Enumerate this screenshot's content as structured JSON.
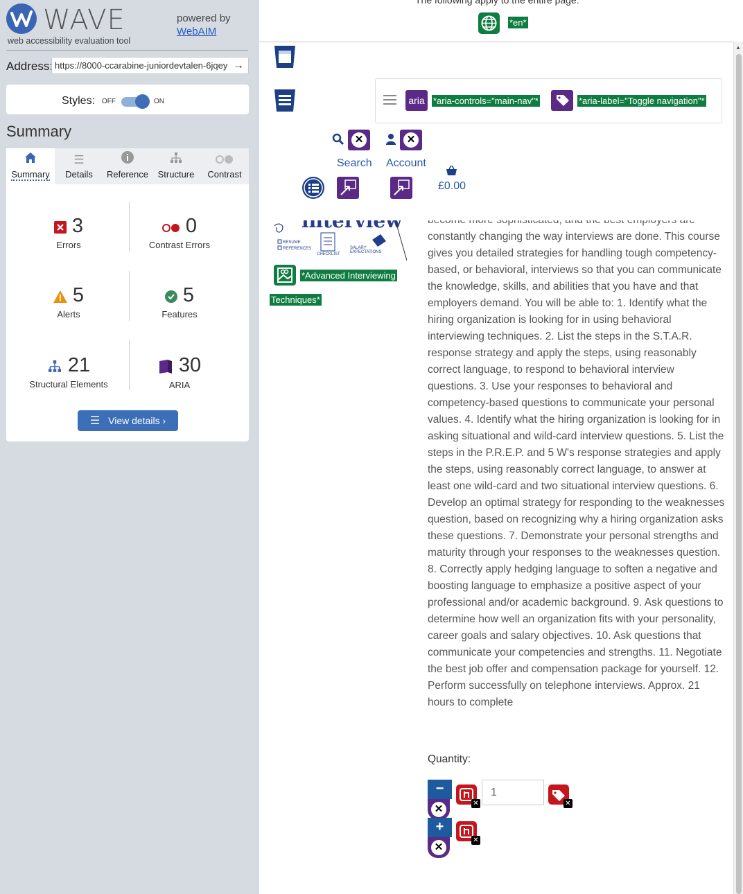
{
  "wave": {
    "logo_word": "WAVE",
    "logo_sub": "web accessibility evaluation tool",
    "powered_by": "powered by",
    "webaim": "WebAIM",
    "address_label": "Address:",
    "address_value": "https://8000-ccarabine-juniordevtalen-6jqey",
    "styles_label": "Styles:",
    "styles_off": "OFF",
    "styles_on": "ON",
    "summary_title": "Summary",
    "tabs": [
      "Summary",
      "Details",
      "Reference",
      "Structure",
      "Contrast"
    ],
    "stats": {
      "errors": {
        "num": "3",
        "label": "Errors"
      },
      "contrast": {
        "num": "0",
        "label": "Contrast Errors"
      },
      "alerts": {
        "num": "5",
        "label": "Alerts"
      },
      "features": {
        "num": "5",
        "label": "Features"
      },
      "structural": {
        "num": "21",
        "label": "Structural Elements"
      },
      "aria": {
        "num": "30",
        "label": "ARIA"
      }
    },
    "view_details": "View details ›",
    "colors": {
      "brand": "#3c64b4",
      "sidebar_bg": "#d6dbe2",
      "error": "#c4161c",
      "feature": "#0f7d40",
      "aria": "#5b2a86"
    }
  },
  "page": {
    "top_note": "The following apply to the entire page:",
    "lang_tag": "*en*",
    "aria_badge": "aria",
    "aria_controls": "*aria-controls=\"main-nav\"*",
    "aria_label": "*aria-label=\"Toggle navigation\"*",
    "search": "Search",
    "account": "Account",
    "basket": "£0.00",
    "alt_text_1": "*Advanced Interviewing",
    "alt_text_2": "Techniques*",
    "description": "become more sophisticated, and the best employers are constantly changing the way interviews are done. This course gives you detailed strategies for handling tough competency-based, or behavioral, interviews so that you can communicate the knowledge, skills, and abilities that you have and that employers demand. You will be able to: 1. Identify what the hiring organization is looking for in using behavioral interviewing techniques. 2. List the steps in the S.T.A.R. response strategy and apply the steps, using reasonably correct language, to respond to behavioral interview questions. 3. Use your responses to behavioral and competency-based questions to communicate your personal values. 4. Identify what the hiring organization is looking for in asking situational and wild-card interview questions. 5. List the steps in the P.R.E.P. and 5 W's response strategies and apply the steps, using reasonably correct language, to answer at least one wild-card and two situational interview questions. 6. Develop an optimal strategy for responding to the weaknesses question, based on recognizing why a hiring organization asks these questions. 7. Demonstrate your personal strengths and maturity through your responses to the weaknesses question. 8. Correctly apply hedging language to soften a negative and boosting language to emphasize a positive aspect of your professional and/or academic background. 9. Ask questions to determine how well an organization fits with your personality, career goals and salary objectives. 10. Ask questions that communicate your competencies and strengths. 11. Negotiate the best job offer and compensation package for yourself. 12. Perform successfully on telephone interviews. Approx. 21 hours to complete",
    "quantity_label": "Quantity:",
    "qty_minus": "−",
    "qty_plus": "+",
    "qty_value": "1",
    "thumb_text": "interview",
    "thumb_labels": [
      "RESUME",
      "REFERENCES",
      "CHECKLIST",
      "SALARY EXPECTATIONS"
    ]
  }
}
